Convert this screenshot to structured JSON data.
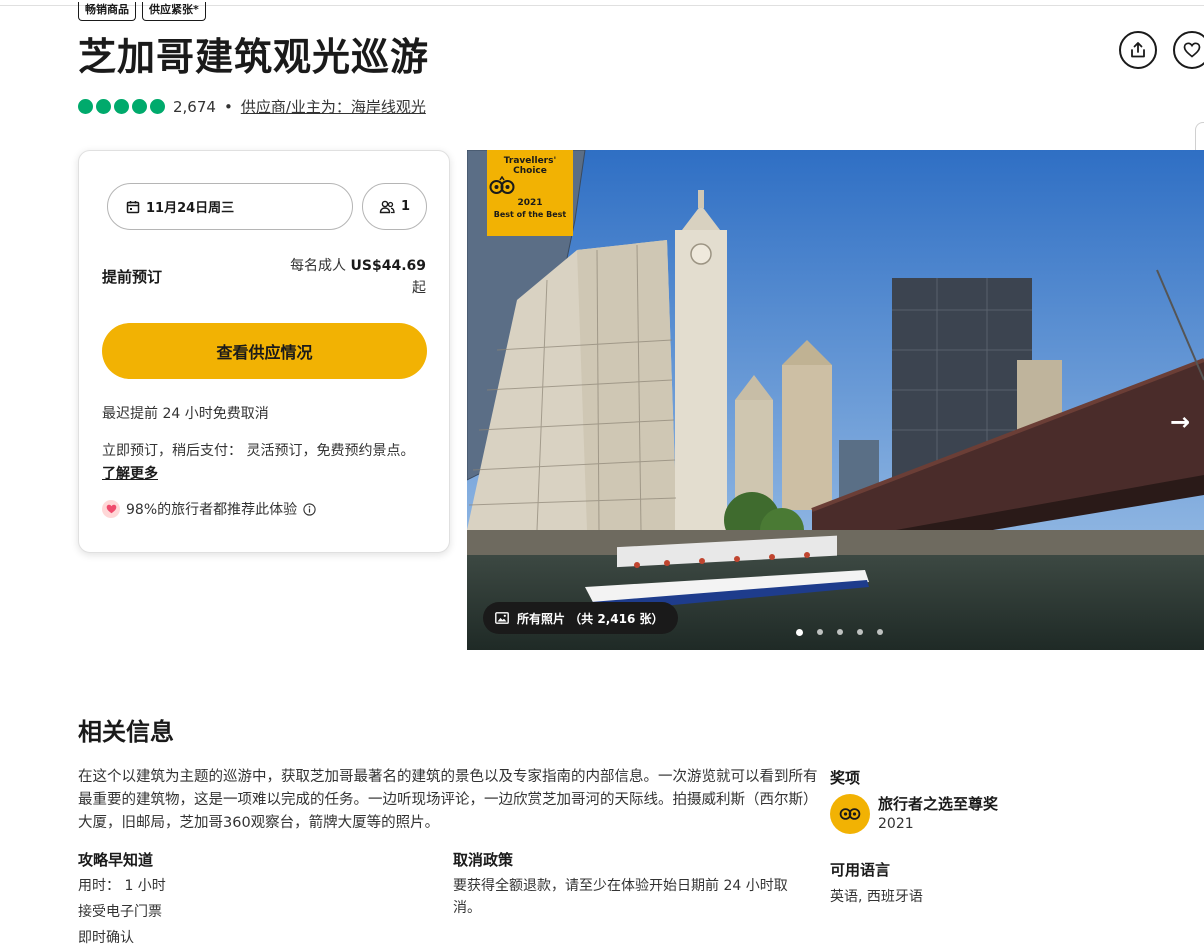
{
  "tags": [
    "畅销商品",
    "供应紧张*"
  ],
  "title": "芝加哥建筑观光巡游",
  "rating": {
    "bubbles": 5,
    "review_count": "2,674",
    "supplier": "供应商/业主为：海岸线观光"
  },
  "booking": {
    "date": "11月24日周三",
    "travelers": "1",
    "reserve_label": "提前预订",
    "price_prefix": "每名成人",
    "price": "US$44.69",
    "price_suffix": "起",
    "cta": "查看供应情况",
    "cancel_note": "最迟提前 24 小时免费取消",
    "pay_note": "立即预订，稍后支付： 灵活预订，免费预约景点。",
    "learn_more": "了解更多",
    "recommend": "98%的旅行者都推荐此体验"
  },
  "photo": {
    "badge_line1": "Travellers'",
    "badge_line2": "Choice",
    "badge_year": "2021",
    "badge_best": "Best of the Best",
    "all_photos": "所有照片 （共 2,416 张）",
    "dots": 5,
    "active_dot": 1
  },
  "info": {
    "heading": "相关信息",
    "description": "在这个以建筑为主题的巡游中，获取芝加哥最著名的建筑的景色以及专家指南的内部信息。一次游览就可以看到所有最重要的建筑物，这是一项难以完成的任务。一边听现场评论，一边欣赏芝加哥河的天际线。拍摄威利斯（西尔斯）大厦，旧邮局，芝加哥360观察台，箭牌大厦等的照片。",
    "know_heading": "攻略早知道",
    "duration": "用时： 1 小时",
    "eticket": "接受电子门票",
    "cut_line": "即时确认",
    "cancel_heading": "取消政策",
    "cancel_text": "要获得全额退款，请至少在体验开始日期前 24 小时取消。",
    "awards_heading": "奖项",
    "award_name": "旅行者之选至尊奖",
    "award_year": "2021",
    "languages_heading": "可用语言",
    "languages": "英语, 西班牙语"
  },
  "colors": {
    "accent": "#f2b203",
    "rating": "#00aa6c",
    "text": "#1a1a1a"
  }
}
